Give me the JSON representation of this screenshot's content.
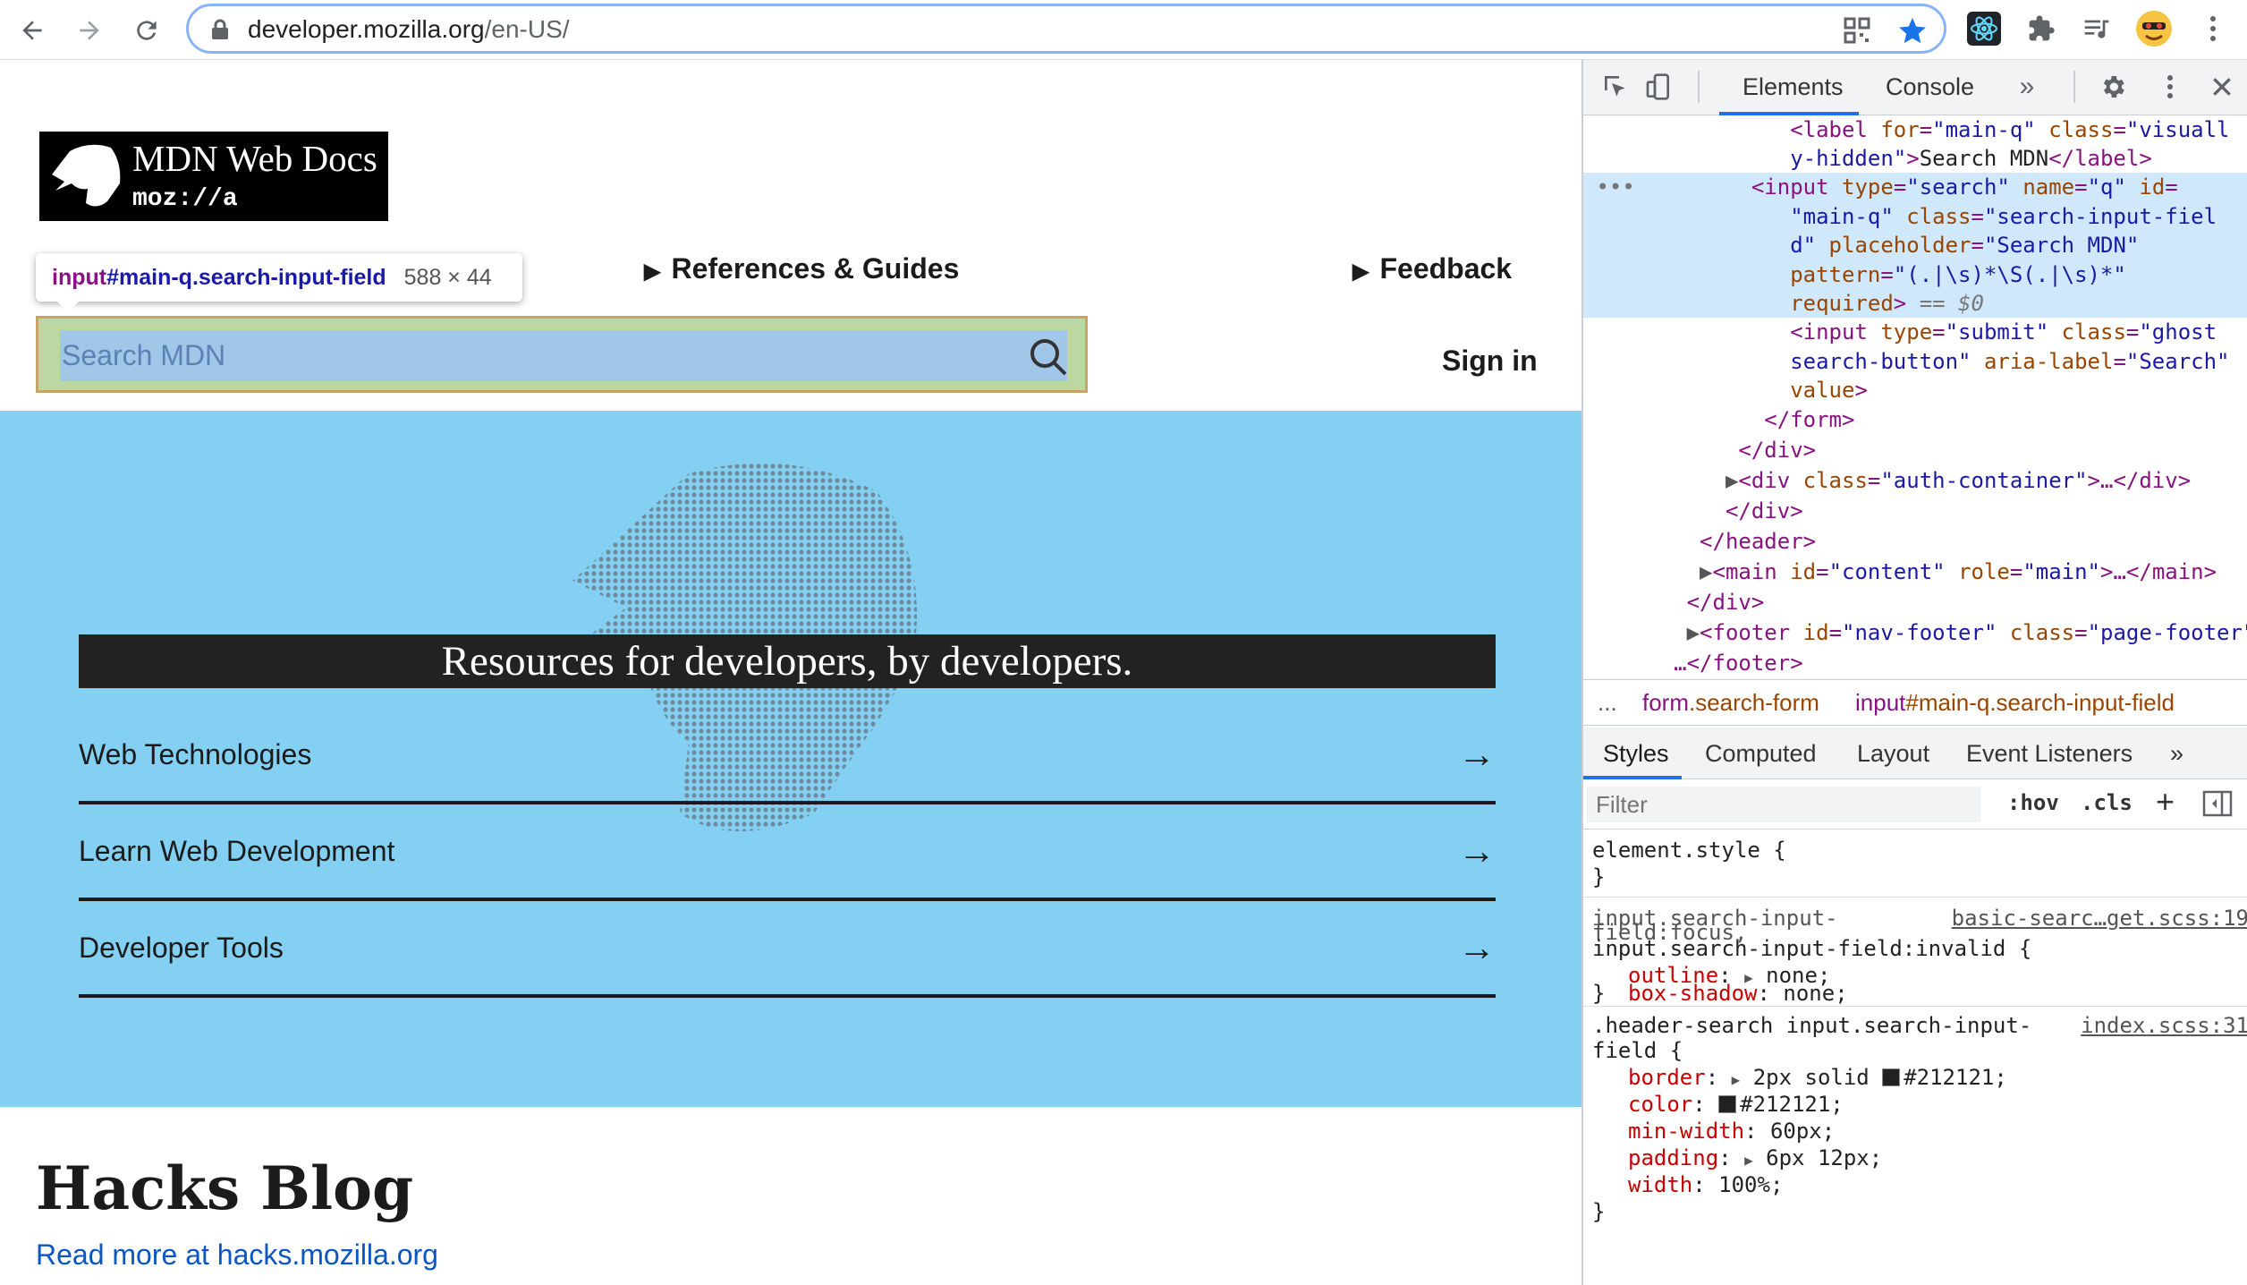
{
  "browser": {
    "back_icon": "arrow-left-icon",
    "forward_icon": "arrow-right-icon",
    "reload_icon": "reload-icon",
    "url_host": "developer.mozilla.org",
    "url_path": "/en-US/",
    "extensions": [
      "qr-code-icon",
      "star-icon",
      "react-devtools-icon",
      "puzzle-icon",
      "media-queue-icon",
      "avatar",
      "more-vert-icon"
    ]
  },
  "page": {
    "logo": {
      "text": "MDN Web Docs",
      "moz": "moz://a"
    },
    "menu": {
      "references": "References & Guides",
      "feedback": "Feedback",
      "sign_in": "Sign in"
    },
    "tooltip": {
      "tag": "input",
      "id_class": "#main-q.search-input-field",
      "size": "588 × 44"
    },
    "search": {
      "placeholder": "Search MDN"
    },
    "hero": {
      "tagline": "Resources for developers, by developers.",
      "links": [
        "Web Technologies",
        "Learn Web Development",
        "Developer Tools"
      ]
    },
    "blog": {
      "title": "Hacks Blog",
      "link": "Read more at hacks.mozilla.org"
    }
  },
  "devtools": {
    "tabs": {
      "elements": "Elements",
      "console": "Console"
    },
    "crumbs": {
      "dots": "...",
      "c1_tag": "form",
      "c1_cls": ".search-form",
      "c2_tag": "input",
      "c2_id": "#main-q.search-input-field"
    },
    "styles_tabs": [
      "Styles",
      "Computed",
      "Layout",
      "Event Listeners"
    ],
    "filter": {
      "placeholder": "Filter",
      "hov": ":hov",
      "cls": ".cls"
    },
    "rules": {
      "element_style": "element.style {",
      "r1_sel1": "input.search-input-",
      "r1_sel2": "field:focus,",
      "r1_sel3": "input.search-input-field:invalid {",
      "r1_src": "basic-searc…get.scss:19",
      "r1_p1": "outline",
      "r1_v1": "none;",
      "r1_p2": "box-shadow",
      "r1_v2": "none;",
      "r2_sel1": ".header-search input.search-input-",
      "r2_sel2": "field {",
      "r2_src": "index.scss:31",
      "r2_p1": "border",
      "r2_v1": "2px solid ",
      "r2_v1b": "#212121;",
      "r2_p2": "color",
      "r2_v2": "#212121;",
      "r2_p3": "min-width",
      "r2_v3": "60px;",
      "r2_p4": "padding",
      "r2_v4": "6px 12px;",
      "r2_p5": "width",
      "r2_v5": "100%;",
      "close": "}"
    }
  }
}
